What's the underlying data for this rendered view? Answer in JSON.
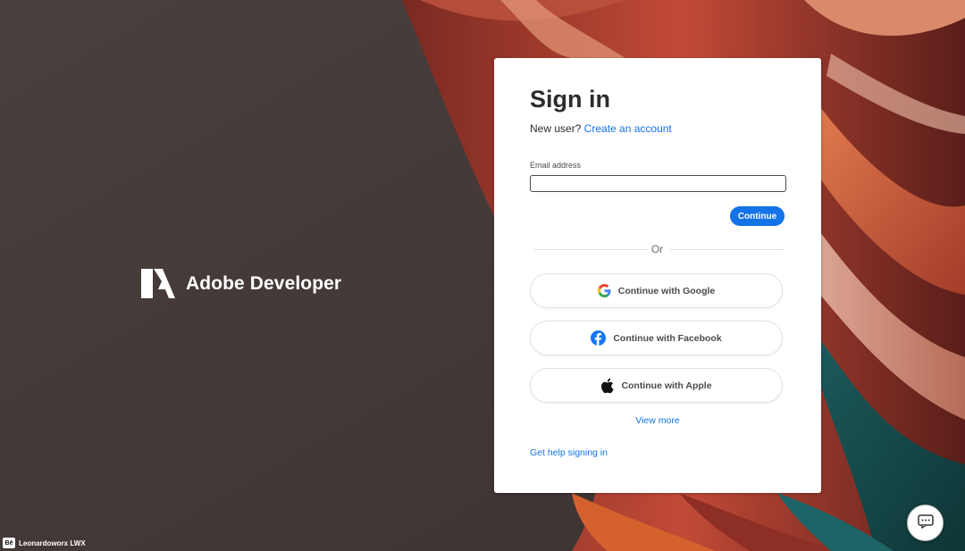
{
  "brand": {
    "name": "Adobe Developer",
    "logo_icon": "adobe-logo-icon"
  },
  "signin": {
    "title": "Sign in",
    "new_user_text": "New user?",
    "create_account_link": "Create an account",
    "email_label": "Email address",
    "email_value": "",
    "continue_label": "Continue",
    "or_label": "Or",
    "social": {
      "google_label": "Continue with Google",
      "facebook_label": "Continue with Facebook",
      "apple_label": "Continue with Apple"
    },
    "view_more": "View more",
    "help_link": "Get help signing in"
  },
  "credit": {
    "badge": "Bē",
    "text": "Leonardoworx LWX"
  },
  "colors": {
    "accent": "#1473e6",
    "background_dark": "#463d3b",
    "facebook_blue": "#1877f2"
  },
  "icons": {
    "google": "google-icon",
    "facebook": "facebook-icon",
    "apple": "apple-icon",
    "chat": "chat-bubble-icon"
  }
}
